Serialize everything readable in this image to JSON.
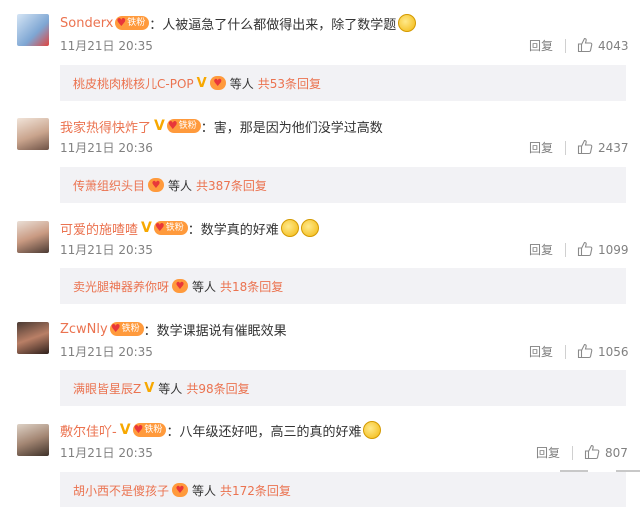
{
  "labels": {
    "reply": "回复",
    "people": "等人",
    "fan_badge": "铁粉"
  },
  "comments": [
    {
      "user": "Sonderx",
      "text": "：人被逼急了什么都做得出来，除了数学题",
      "time": "11月21日 20:35",
      "likes": "4043",
      "sub": {
        "user": "桃皮桃肉桃核儿C-POP",
        "total": "共53条回复"
      }
    },
    {
      "user": "我家热得快炸了",
      "text": "：害，那是因为他们没学过高数",
      "time": "11月21日 20:36",
      "likes": "2437",
      "sub": {
        "user": "传萧组织头目",
        "total": "共387条回复"
      }
    },
    {
      "user": "可爱的施喳喳",
      "text": "：数学真的好难",
      "time": "11月21日 20:35",
      "likes": "1099",
      "sub": {
        "user": "卖光腿神器养你呀",
        "total": "共18条回复"
      }
    },
    {
      "user": "ZcwNly",
      "text": "：数学课据说有催眠效果",
      "time": "11月21日 20:35",
      "likes": "1056",
      "sub": {
        "user": "满眼皆星辰Z",
        "total": "共98条回复"
      }
    },
    {
      "user": "敷尔佳吖-",
      "text": "：八年级还好吧，高三的真的好难",
      "time": "11月21日 20:35",
      "likes": "807",
      "sub": {
        "user": "胡小西不是傻孩子",
        "total": "共172条回复"
      }
    }
  ],
  "colors": {
    "username": "#eb7350",
    "v_badge": "#f7a800",
    "fan_badge": "#ff9a3c",
    "muted": "#808080",
    "reply_box": "#f2f2f5"
  },
  "icons": {
    "like": "thumbs-up-icon",
    "emoji": "smiley-emoji-icon",
    "verified": "v-badge-icon",
    "fan": "fan-badge-icon"
  }
}
